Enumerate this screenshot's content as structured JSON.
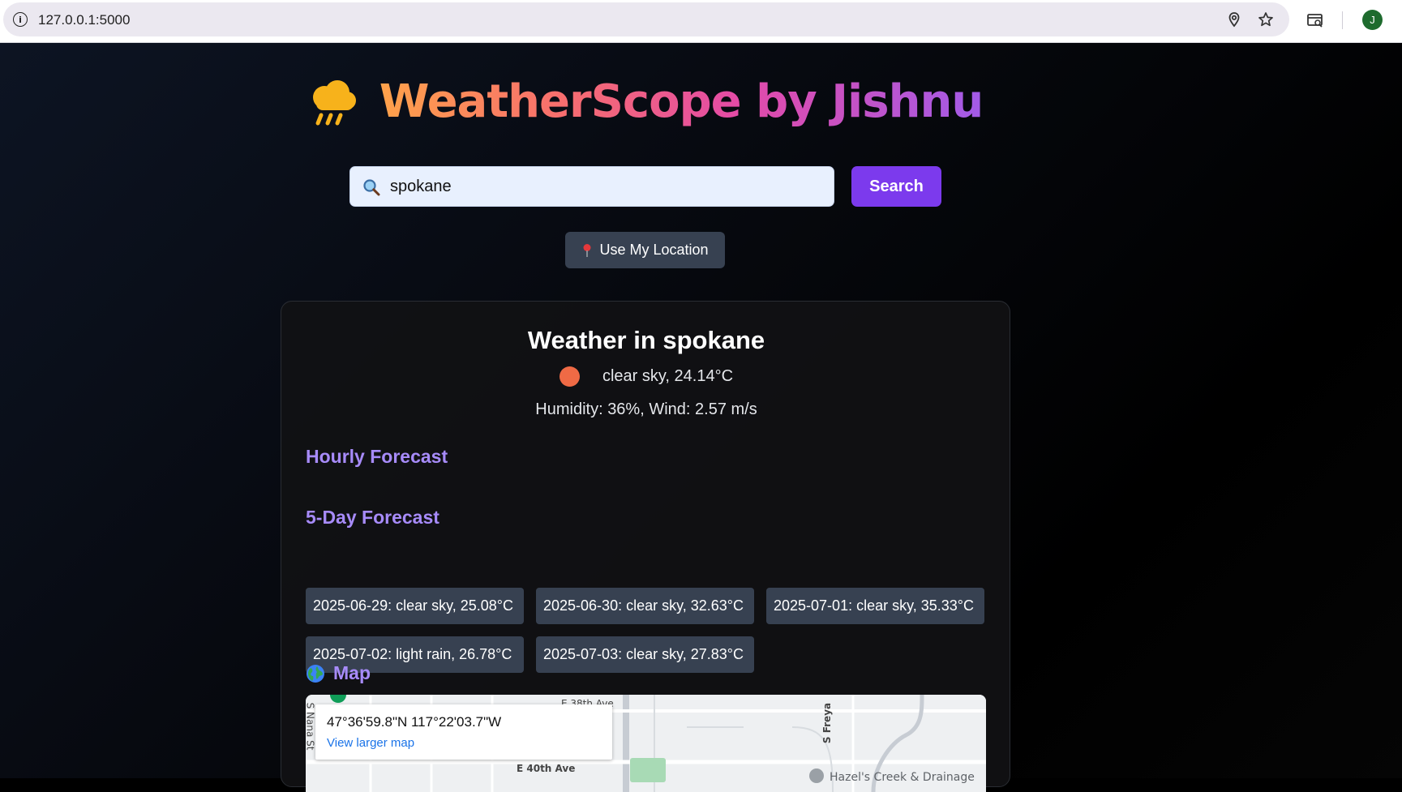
{
  "browser": {
    "url": "127.0.0.1:5000",
    "profile_initial": "J"
  },
  "header": {
    "title": "WeatherScope by Jishnu",
    "icon": "rain-cloud-icon"
  },
  "search": {
    "value": "spokane",
    "button_label": "Search",
    "location_button_label": "Use My Location"
  },
  "current": {
    "title": "Weather in spokane",
    "condition": "clear sky, 24.14°C",
    "stats": "Humidity: 36%, Wind: 2.57 m/s"
  },
  "sections": {
    "hourly": "Hourly Forecast",
    "five_day": "5-Day Forecast",
    "map": "Map"
  },
  "forecast": [
    "2025-06-29: clear sky, 25.08°C",
    "2025-06-30: clear sky, 32.63°C",
    "2025-07-01: clear sky, 35.33°C",
    "2025-07-02: light rain, 26.78°C",
    "2025-07-03: clear sky, 27.83°C"
  ],
  "map": {
    "coords": "47°36'59.8\"N 117°22'03.7\"W",
    "link": "View larger map",
    "labels": {
      "street_38th": "E 38th Ave",
      "street_40th": "E 40th Ave",
      "freya": "S Freya",
      "nana": "S Nana St",
      "poi": "Hazel's Creek & Drainage"
    }
  },
  "colors": {
    "accent": "#7c3aed",
    "section_heading": "#a78bfa",
    "tile_bg": "#374151",
    "sun": "#ef6a45"
  }
}
